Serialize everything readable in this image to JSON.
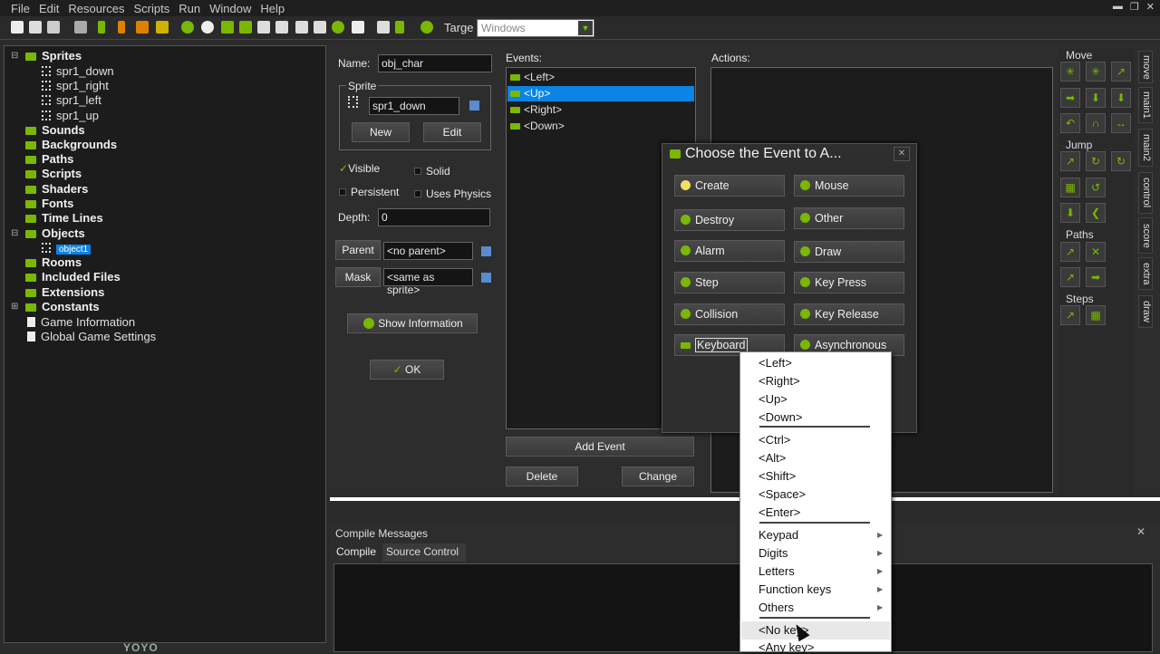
{
  "menu": [
    "File",
    "Edit",
    "Resources",
    "Scripts",
    "Run",
    "Window",
    "Help"
  ],
  "toolbar": {
    "target_label": "Targe",
    "target_value": "Windows"
  },
  "tree": {
    "sprites": "Sprites",
    "sprite_items": [
      "spr1_down",
      "spr1_right",
      "spr1_left",
      "spr1_up"
    ],
    "sounds": "Sounds",
    "backgrounds": "Backgrounds",
    "paths": "Paths",
    "scripts": "Scripts",
    "shaders": "Shaders",
    "fonts": "Fonts",
    "timelines": "Time Lines",
    "objects": "Objects",
    "object_item": "object1",
    "rooms": "Rooms",
    "included": "Included Files",
    "extensions": "Extensions",
    "constants": "Constants",
    "game_info": "Game Information",
    "global_settings": "Global Game Settings"
  },
  "object": {
    "name_label": "Name:",
    "name_value": "obj_char",
    "sprite_group": "Sprite",
    "sprite_value": "spr1_down",
    "new_label": "New",
    "edit_label": "Edit",
    "visible": "Visible",
    "solid": "Solid",
    "persistent": "Persistent",
    "physics": "Uses Physics",
    "depth_label": "Depth:",
    "depth_value": "0",
    "parent_label": "Parent",
    "parent_value": "<no parent>",
    "mask_label": "Mask",
    "mask_value": "<same as sprite>",
    "show_info": "Show Information",
    "ok": "OK"
  },
  "events": {
    "label": "Events:",
    "items": [
      "<Left>",
      "<Up>",
      "<Right>",
      "<Down>"
    ],
    "add": "Add Event",
    "delete": "Delete",
    "change": "Change"
  },
  "actions": {
    "label": "Actions:"
  },
  "palette": {
    "move": "Move",
    "jump": "Jump",
    "paths": "Paths",
    "steps": "Steps",
    "tabs": [
      "move",
      "main1",
      "main2",
      "control",
      "score",
      "extra",
      "draw"
    ]
  },
  "compile": {
    "title": "Compile Messages",
    "tab_compile": "Compile",
    "tab_source": "Source Control"
  },
  "brand": "YOYO",
  "dialog": {
    "title": "Choose the Event to A...",
    "buttons": {
      "create": "Create",
      "mouse": "Mouse",
      "destroy": "Destroy",
      "other": "Other",
      "alarm": "Alarm",
      "draw": "Draw",
      "step": "Step",
      "keypress": "Key Press",
      "collision": "Collision",
      "keyrelease": "Key Release",
      "keyboard": "Keyboard",
      "async": "Asynchronous"
    }
  },
  "keymenu": {
    "arrows": [
      "<Left>",
      "<Right>",
      "<Up>",
      "<Down>"
    ],
    "mods": [
      "<Ctrl>",
      "<Alt>",
      "<Shift>",
      "<Space>",
      "<Enter>"
    ],
    "groups": [
      "Keypad",
      "Digits",
      "Letters",
      "Function keys",
      "Others"
    ],
    "special": [
      "<No key>",
      "<Any key>"
    ]
  },
  "colors": {
    "accent": "#7ab800",
    "selection": "#0a84e6"
  }
}
